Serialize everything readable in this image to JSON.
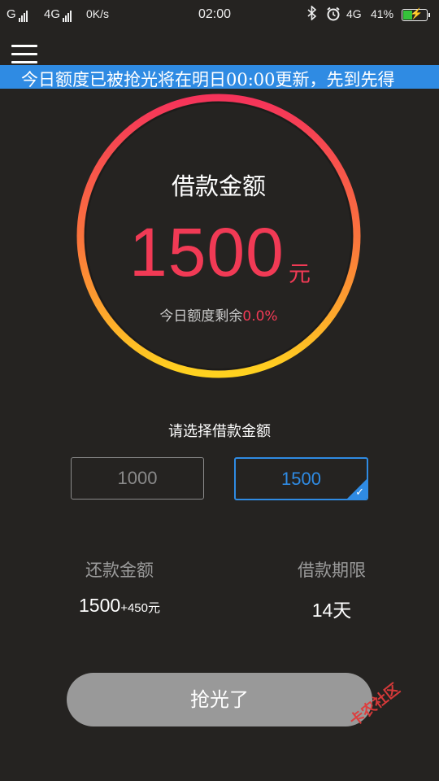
{
  "status_bar": {
    "carrier1": "G",
    "carrier2": "4G",
    "speed": "0K/s",
    "time": "02:00",
    "network": "4G",
    "battery_text": "41%",
    "battery_level": 0.41
  },
  "banner": {
    "text": "今日额度已被抢光将在明日00:00更新，先到先得"
  },
  "loan_circle": {
    "title": "借款金额",
    "amount": "1500",
    "unit": "元",
    "remaining_label": "今日额度剩余",
    "remaining_value": "0.0%"
  },
  "choose_label": "请选择借款金额",
  "options": [
    {
      "label": "1000",
      "selected": false
    },
    {
      "label": "1500",
      "selected": true
    }
  ],
  "repay": {
    "label": "还款金额",
    "value": "1500",
    "extra": "+450元"
  },
  "term": {
    "label": "借款期限",
    "value": "14天"
  },
  "action_button": "抢光了",
  "watermark": "卡农社区",
  "colors": {
    "accent_blue": "#2f8be3",
    "amount_red": "#f13a55",
    "ring_top": "#f5335a",
    "ring_bottom": "#ffd21f",
    "background": "#252321"
  }
}
